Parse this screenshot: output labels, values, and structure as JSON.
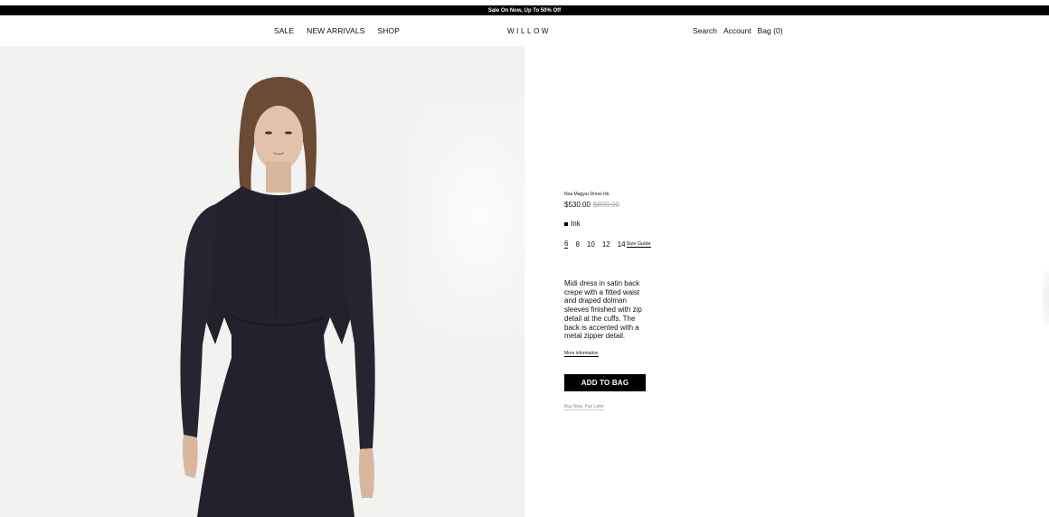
{
  "announcement": "Sale On Now, Up To 50% Off",
  "nav": {
    "left": [
      "SALE",
      "NEW ARRIVALS",
      "SHOP"
    ],
    "logo": "WILLOW",
    "right": [
      "Search",
      "Account",
      "Bag (0)"
    ]
  },
  "product": {
    "name": "Noa Magyar Dress Ink",
    "price": "$530.00",
    "original_price": "$890.00",
    "color": "Ink",
    "sizes": [
      "6",
      "8",
      "10",
      "12",
      "14"
    ],
    "selected_size": "6",
    "size_guide": "Size Guide",
    "description": "Midi dress in satin back crepe with a fitted waist and draped dolman sleeves finished with zip detail at the cuffs. The back is accented with a metal zipper detail.",
    "more_info": "More information",
    "add_to_bag": "ADD TO BAG",
    "bnpl": "Buy Now, Pay Later"
  },
  "colors": {
    "announce_bg": "#000000",
    "button_bg": "#000000",
    "swatch": "#000000"
  }
}
